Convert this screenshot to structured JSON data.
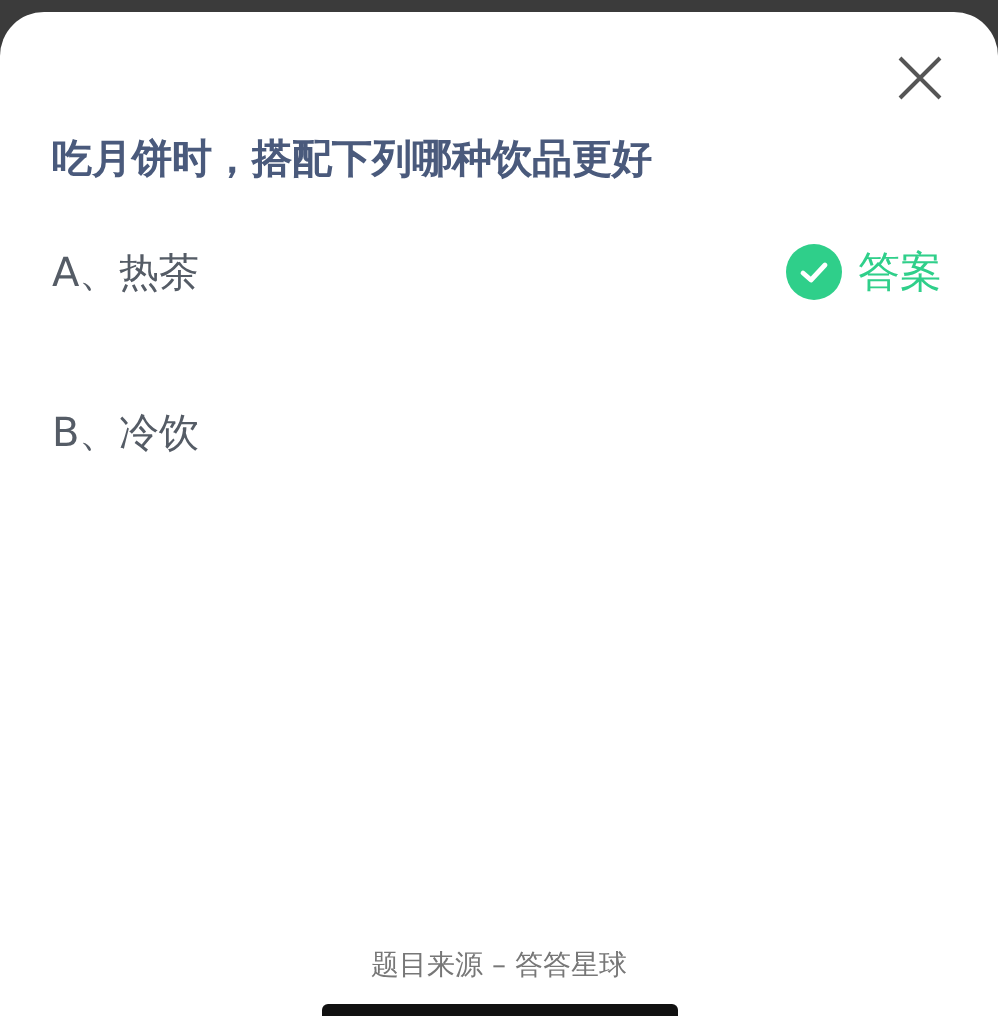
{
  "question": "吃月饼时，搭配下列哪种饮品更好",
  "options": [
    {
      "label": "A、热茶",
      "correct": true,
      "answer_label": "答案"
    },
    {
      "label": "B、冷饮",
      "correct": false
    }
  ],
  "source": "题目来源 – 答答星球"
}
